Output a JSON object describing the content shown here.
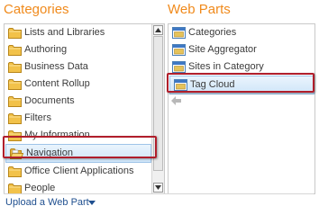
{
  "categories_section": {
    "title": "Categories",
    "items": [
      {
        "label": "Lists and Libraries",
        "icon": "folder-icon"
      },
      {
        "label": "Authoring",
        "icon": "folder-icon"
      },
      {
        "label": "Business Data",
        "icon": "folder-icon"
      },
      {
        "label": "Content Rollup",
        "icon": "folder-icon"
      },
      {
        "label": "Documents",
        "icon": "folder-icon"
      },
      {
        "label": "Filters",
        "icon": "folder-icon"
      },
      {
        "label": "My Information",
        "icon": "folder-icon"
      },
      {
        "label": "Navigation",
        "icon": "folder-icon",
        "selected": true
      },
      {
        "label": "Office Client Applications",
        "icon": "folder-icon"
      },
      {
        "label": "People",
        "icon": "folder-icon"
      }
    ]
  },
  "webparts_section": {
    "title": "Web Parts",
    "items": [
      {
        "label": "Categories",
        "icon": "webpart-icon"
      },
      {
        "label": "Site Aggregator",
        "icon": "webpart-icon"
      },
      {
        "label": "Sites in Category",
        "icon": "webpart-icon"
      },
      {
        "label": "Tag Cloud",
        "icon": "webpart-icon",
        "selected": true
      }
    ]
  },
  "footer": {
    "upload_label": "Upload a Web Part"
  },
  "colors": {
    "heading": "#f08a1c",
    "highlight_border": "#b01e2b",
    "selection_fill": "#cfe5f8",
    "link": "#1f4f8f"
  }
}
